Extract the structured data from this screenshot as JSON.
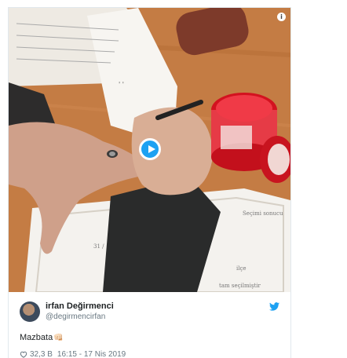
{
  "tweet": {
    "author_name": "irfan Değirmenci",
    "author_handle": "@degirmencirfan",
    "text": "Mazbata",
    "text_emoji": "👊🏻",
    "like_count": "32,3 B",
    "timestamp": "16:15 - 17 Nis 2019"
  },
  "media": {
    "info_glyph": "i",
    "paper_text": {
      "line1": "31 /",
      "line2": "Seçimi sonucu",
      "line3": "ilçe",
      "line4": "tam seçilmiştir"
    }
  },
  "icons": {
    "brand": "bird-icon",
    "like": "heart-icon",
    "play": "play-icon",
    "info": "info-icon"
  },
  "colors": {
    "brand_blue": "#1da1f2",
    "text_dark": "#1c2022",
    "text_muted": "#697882",
    "heart": "#e0245e"
  }
}
